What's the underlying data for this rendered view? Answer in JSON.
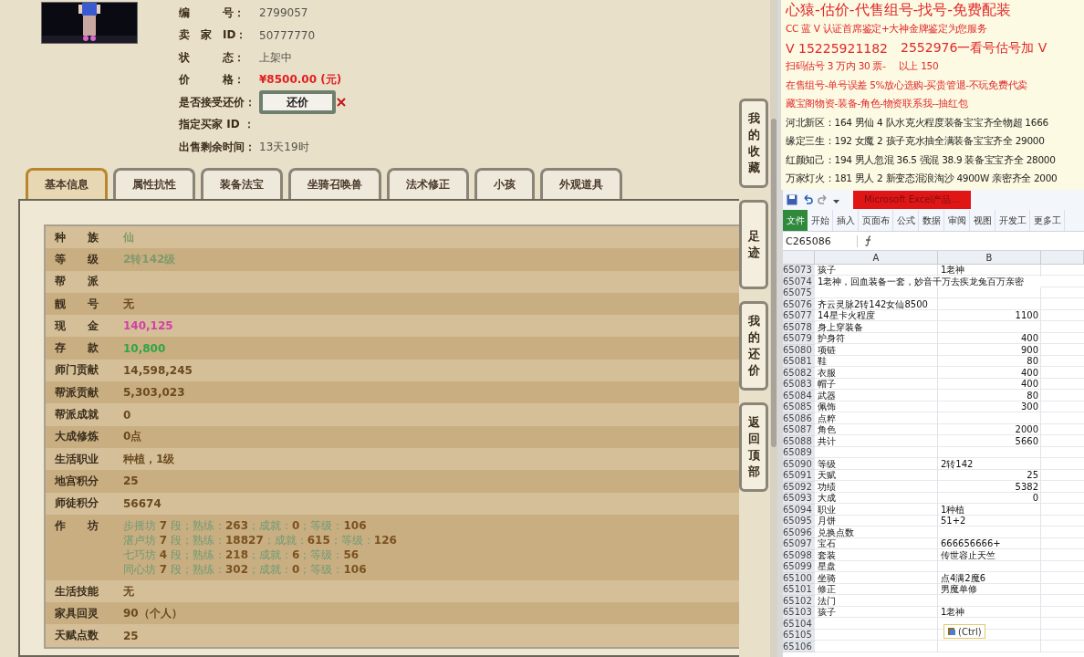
{
  "listing": {
    "fields": [
      {
        "kind": "text",
        "label": "编　　　号：",
        "value": "2799057"
      },
      {
        "kind": "text",
        "label": "卖　家　ID：",
        "value": "50777770"
      },
      {
        "kind": "text",
        "label": "状　　　态：",
        "value": "上架中"
      },
      {
        "kind": "price",
        "label": "价　　　格：",
        "value": "¥8500.00 (元)"
      },
      {
        "kind": "button",
        "label": "是否接受还价：",
        "value": "还价"
      },
      {
        "kind": "text",
        "label": "指定买家 ID ："
      },
      {
        "kind": "text",
        "label": "出售剩余时间：",
        "value": "13天19时"
      }
    ]
  },
  "tabs": [
    {
      "label": "基本信息",
      "selected": true
    },
    {
      "label": "属性抗性",
      "selected": false
    },
    {
      "label": "装备法宝",
      "selected": false
    },
    {
      "label": "坐骑召唤兽",
      "selected": false
    },
    {
      "label": "法术修正",
      "selected": false
    },
    {
      "label": "小孩",
      "selected": false
    },
    {
      "label": "外观道具",
      "selected": false
    }
  ],
  "info_table": [
    {
      "label": "种　　族",
      "value": "仙",
      "color": "#7f9a6c"
    },
    {
      "label": "等　　级",
      "value": "2转142级",
      "color": "#7f9a6c"
    },
    {
      "label": "帮　　派"
    },
    {
      "label": "靓　　号",
      "value": "无",
      "color": "#6b4a1e"
    },
    {
      "label": "现　　金",
      "value": "140,125",
      "color": "#d23fa8"
    },
    {
      "label": "存　　款",
      "value": "10,800",
      "color": "#2ea546"
    },
    {
      "label": "师门贡献",
      "value": "14,598,245",
      "color": "#6b4a1e"
    },
    {
      "label": "帮派贡献",
      "value": "5,303,023",
      "color": "#6b4a1e"
    },
    {
      "label": "帮派成就",
      "value": "0",
      "color": "#6b4a1e"
    },
    {
      "label": "大成修炼",
      "value": "0点",
      "color": "#6b4a1e"
    },
    {
      "label": "生活职业",
      "value": "种植，1级",
      "color": "#6b4a1e"
    },
    {
      "label": "地宫积分",
      "value": "25",
      "color": "#6b4a1e"
    },
    {
      "label": "师徒积分",
      "value": "56674",
      "color": "#6b4a1e"
    },
    {
      "label": "作　　坊",
      "lines": [
        "步摇坊 **7** 段；熟练：**263**；成就：**0**；等级：**106**",
        "湛卢坊 **7** 段；熟练：**18827**；成就：**615**；等级：**126**",
        "七巧坊 **4** 段；熟练：**218**；成就：**6**；等级：**56**",
        "同心坊 **7** 段；熟练：**302**；成就：**0**；等级：**106**"
      ],
      "color": "#6f9a72"
    },
    {
      "label": "生活技能",
      "value": "无",
      "color": "#6b4a1e"
    },
    {
      "label": "家具回灵",
      "value": "90（个人）",
      "color": "#6b4a1e"
    },
    {
      "label": "天赋点数",
      "value": "25",
      "color": "#6b4a1e"
    }
  ],
  "side_buttons": [
    "我的收藏",
    "足迹",
    "我的还价",
    "返回顶部"
  ],
  "notice": [
    {
      "texts": [
        "心猿-估价-代售组号-找号-免费配装"
      ],
      "color": "#e0292b",
      "kind": "title"
    },
    {
      "texts": [
        "CC 蓝 V 认证首席鉴定+大神金牌鉴定为您服务"
      ],
      "color": "#e0292b",
      "kind": "normal"
    },
    {
      "texts": [
        "V 15225921182",
        "2552976一看号估号加 V"
      ],
      "color": "#e0292b",
      "kind": "large"
    },
    {
      "texts": [
        "扫码估号 3 万内 30 票-",
        "以上 150"
      ],
      "color": "#e0292b",
      "kind": "normal"
    },
    {
      "texts": [
        "在售组号-单号误差 5%放心选购-买贵管退-不玩免费代卖"
      ],
      "color": "#e0292b",
      "kind": "normal"
    },
    {
      "texts": [
        "藏宝阁物资-装备-角色-物资联系我--抽红包"
      ],
      "color": "#e0292b",
      "kind": "normal"
    },
    {
      "texts": [
        "河北新区：164 男仙 4 队水克火程度装备宝宝齐全物超 1666"
      ],
      "color": "#222222",
      "kind": "normal"
    },
    {
      "texts": [
        "缘定三生：192 女魔 2 孩子克水抽全满装备宝宝齐全 29000"
      ],
      "color": "#222222",
      "kind": "normal"
    },
    {
      "texts": [
        "红颜知己：194 男人忽混 36.5 强混 38.9 装备宝宝齐全 28000"
      ],
      "color": "#222222",
      "kind": "normal"
    },
    {
      "texts": [
        "万家灯火：181 男人 2 新变态混浪淘沙 4900W 亲密齐全 2000"
      ],
      "color": "#222222",
      "kind": "normal"
    }
  ],
  "excel": {
    "title": "Microsoft Excel产品...",
    "ribbon": [
      {
        "label": "文件",
        "kind": "file"
      },
      {
        "label": "开始",
        "kind": "tab"
      },
      {
        "label": "插入",
        "kind": "tab"
      },
      {
        "label": "页面布",
        "kind": "tab"
      },
      {
        "label": "公式",
        "kind": "tab"
      },
      {
        "label": "数据",
        "kind": "tab"
      },
      {
        "label": "审阅",
        "kind": "tab"
      },
      {
        "label": "视图",
        "kind": "tab"
      },
      {
        "label": "开发工",
        "kind": "tab"
      },
      {
        "label": "更多工",
        "kind": "tab"
      }
    ],
    "name_box": "C265086",
    "columns": [
      "A",
      "B"
    ],
    "rows": [
      {
        "n": "65073",
        "cells": [
          {
            "text": "孩子",
            "kind": "text"
          },
          {
            "text": "1老神",
            "kind": "text"
          }
        ]
      },
      {
        "n": "65074",
        "cells": [
          {
            "text": "1老神，回血装备一套，妙音千万去疾龙兔百万亲密",
            "kind": "overflow"
          }
        ]
      },
      {
        "n": "65075"
      },
      {
        "n": "65076",
        "cells": [
          {
            "text": "齐云灵脉2转142女仙8500",
            "kind": "text"
          }
        ]
      },
      {
        "n": "65077",
        "cells": [
          {
            "text": "14星卡火程度",
            "kind": "text"
          },
          {
            "text": "1100",
            "kind": "number"
          }
        ]
      },
      {
        "n": "65078",
        "cells": [
          {
            "text": "身上穿装备",
            "kind": "text"
          }
        ]
      },
      {
        "n": "65079",
        "cells": [
          {
            "text": "护身符",
            "kind": "text"
          },
          {
            "text": "400",
            "kind": "number"
          }
        ]
      },
      {
        "n": "65080",
        "cells": [
          {
            "text": "项链",
            "kind": "text"
          },
          {
            "text": "900",
            "kind": "number"
          }
        ]
      },
      {
        "n": "65081",
        "cells": [
          {
            "text": "鞋",
            "kind": "text"
          },
          {
            "text": "80",
            "kind": "number"
          }
        ]
      },
      {
        "n": "65082",
        "cells": [
          {
            "text": "衣服",
            "kind": "text"
          },
          {
            "text": "400",
            "kind": "number"
          }
        ]
      },
      {
        "n": "65083",
        "cells": [
          {
            "text": "帽子",
            "kind": "text"
          },
          {
            "text": "400",
            "kind": "number"
          }
        ]
      },
      {
        "n": "65084",
        "cells": [
          {
            "text": "武器",
            "kind": "text"
          },
          {
            "text": "80",
            "kind": "number"
          }
        ]
      },
      {
        "n": "65085",
        "cells": [
          {
            "text": "佩饰",
            "kind": "text"
          },
          {
            "text": "300",
            "kind": "number"
          }
        ]
      },
      {
        "n": "65086",
        "cells": [
          {
            "text": "点粹",
            "kind": "text"
          }
        ]
      },
      {
        "n": "65087",
        "cells": [
          {
            "text": "角色",
            "kind": "text"
          },
          {
            "text": "2000",
            "kind": "number"
          }
        ]
      },
      {
        "n": "65088",
        "cells": [
          {
            "text": "共计",
            "kind": "text"
          },
          {
            "text": "5660",
            "kind": "number"
          }
        ]
      },
      {
        "n": "65089"
      },
      {
        "n": "65090",
        "cells": [
          {
            "text": "等级",
            "kind": "text"
          },
          {
            "text": "2转142",
            "kind": "text"
          }
        ]
      },
      {
        "n": "65091",
        "cells": [
          {
            "text": "天赋",
            "kind": "text"
          },
          {
            "text": "25",
            "kind": "number"
          }
        ]
      },
      {
        "n": "65092",
        "cells": [
          {
            "text": "功绩",
            "kind": "text"
          },
          {
            "text": "5382",
            "kind": "number"
          }
        ]
      },
      {
        "n": "65093",
        "cells": [
          {
            "text": "大成",
            "kind": "text"
          },
          {
            "text": "0",
            "kind": "number"
          }
        ]
      },
      {
        "n": "65094",
        "cells": [
          {
            "text": "职业",
            "kind": "text"
          },
          {
            "text": "1种植",
            "kind": "text"
          }
        ]
      },
      {
        "n": "65095",
        "cells": [
          {
            "text": "月饼",
            "kind": "text"
          },
          {
            "text": "51+2",
            "kind": "text"
          }
        ]
      },
      {
        "n": "65096",
        "cells": [
          {
            "text": "兑换点数",
            "kind": "text"
          }
        ]
      },
      {
        "n": "65097",
        "cells": [
          {
            "text": "宝石",
            "kind": "text"
          },
          {
            "text": "666656666+",
            "kind": "text"
          }
        ]
      },
      {
        "n": "65098",
        "cells": [
          {
            "text": "套装",
            "kind": "text"
          },
          {
            "text": "传世容止天竺",
            "kind": "text"
          }
        ]
      },
      {
        "n": "65099",
        "cells": [
          {
            "text": "星盘",
            "kind": "text"
          }
        ]
      },
      {
        "n": "65100",
        "cells": [
          {
            "text": "坐骑",
            "kind": "text"
          },
          {
            "text": "点4满2魔6",
            "kind": "text"
          }
        ]
      },
      {
        "n": "65101",
        "cells": [
          {
            "text": "修正",
            "kind": "text"
          },
          {
            "text": "男魔单修",
            "kind": "text"
          }
        ]
      },
      {
        "n": "65102",
        "cells": [
          {
            "text": "法门",
            "kind": "text"
          }
        ]
      },
      {
        "n": "65103",
        "cells": [
          {
            "text": "孩子",
            "kind": "text"
          },
          {
            "text": "1老神",
            "kind": "text"
          }
        ]
      },
      {
        "n": "65104"
      },
      {
        "n": "65105"
      },
      {
        "n": "65106"
      }
    ],
    "paste_options": "(Ctrl)"
  }
}
